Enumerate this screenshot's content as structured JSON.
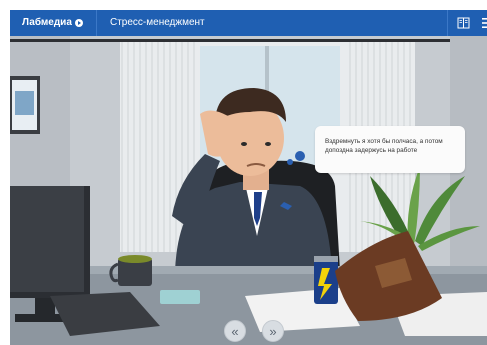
{
  "header": {
    "brand": "Лабмедиа",
    "course_title": "Стресс-менеджмент",
    "glossary_icon": "book-icon",
    "menu_icon": "hamburger-icon"
  },
  "scene": {
    "speech_bubble": "Вздремнуть я хотя бы полчаса, а потом допоздна задержусь на работе",
    "can_label": "ENERGY"
  },
  "nav": {
    "prev_symbol": "«",
    "next_symbol": "»"
  },
  "colors": {
    "header": "#1f5fb2",
    "scene_bg": "#c9ced3"
  }
}
